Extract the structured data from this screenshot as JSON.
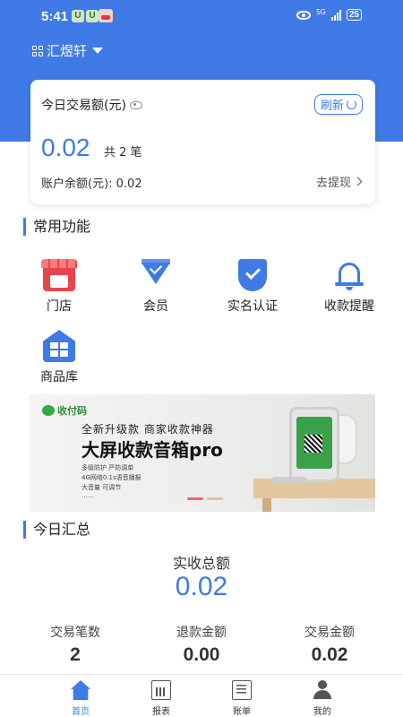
{
  "status_bar": {
    "time": "5:41",
    "app_badge_1": "U",
    "app_badge_2": "U",
    "network": "5G",
    "battery": "25"
  },
  "header": {
    "store_name": "汇煜轩"
  },
  "summary_card": {
    "title": "今日交易额(元)",
    "refresh_label": "刷新",
    "amount": "0.02",
    "count": "共 2 笔",
    "balance": "账户余额(元): 0.02",
    "withdraw_label": "去提现"
  },
  "functions": {
    "section_title": "常用功能",
    "items": [
      {
        "label": "门店",
        "icon": "store-icon"
      },
      {
        "label": "会员",
        "icon": "diamond-icon"
      },
      {
        "label": "实名认证",
        "icon": "shield-check-icon"
      },
      {
        "label": "收款提醒",
        "icon": "bell-icon"
      },
      {
        "label": "商品库",
        "icon": "warehouse-icon"
      }
    ]
  },
  "banner": {
    "logo_text": "收付码",
    "subtitle": "全新升级款 商家收款神器",
    "title": "大屏收款音箱pro",
    "features": [
      "多级防护 严防调单",
      "4G网络0.1s语音播报",
      "大音量 可调节",
      "……"
    ]
  },
  "today_summary": {
    "section_title": "今日汇总",
    "total_label": "实收总额",
    "total_value": "0.02",
    "stats": [
      {
        "label": "交易笔数",
        "value": "2"
      },
      {
        "label": "退款金额",
        "value": "0.00"
      },
      {
        "label": "交易金额",
        "value": "0.02"
      }
    ]
  },
  "tabbar": {
    "items": [
      {
        "label": "首页",
        "icon": "home-icon",
        "active": true
      },
      {
        "label": "报表",
        "icon": "report-icon"
      },
      {
        "label": "账单",
        "icon": "bill-icon"
      },
      {
        "label": "我的",
        "icon": "user-icon"
      }
    ]
  },
  "colors": {
    "primary": "#3f7ae6",
    "store_red": "#e8444a",
    "banner_green": "#2faa45"
  }
}
